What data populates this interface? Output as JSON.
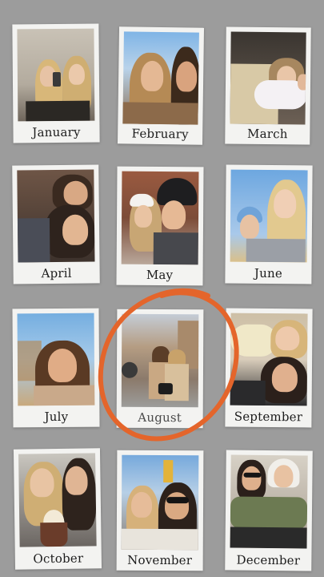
{
  "months": [
    {
      "label": "January"
    },
    {
      "label": "February"
    },
    {
      "label": "March"
    },
    {
      "label": "April"
    },
    {
      "label": "May"
    },
    {
      "label": "June"
    },
    {
      "label": "July"
    },
    {
      "label": "August"
    },
    {
      "label": "September"
    },
    {
      "label": "October"
    },
    {
      "label": "November"
    },
    {
      "label": "December"
    }
  ],
  "highlight": {
    "month": "August",
    "color": "#e4652b"
  }
}
